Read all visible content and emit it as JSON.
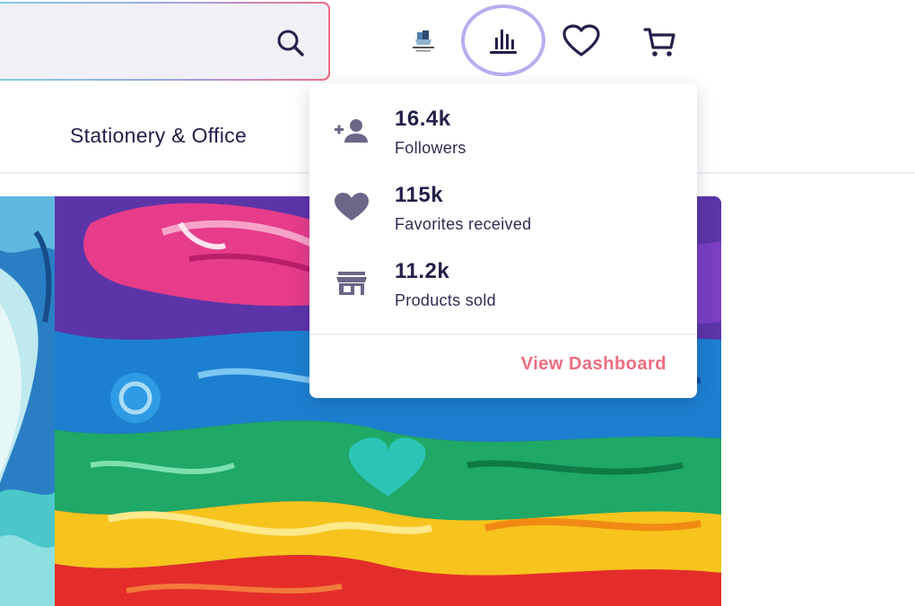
{
  "search": {
    "value": "",
    "placeholder": "",
    "icon": "search-icon"
  },
  "header": {
    "logo_icon": "shop-logo-icon",
    "stats_icon": "bar-chart-icon",
    "favorites_icon": "heart-outline-icon",
    "cart_icon": "cart-icon",
    "stats_ring_color": "#b7aef0"
  },
  "nav": {
    "items": [
      {
        "label": "Stationery & Office"
      }
    ]
  },
  "stats_panel": {
    "items": [
      {
        "icon": "add-follower-icon",
        "value": "16.4k",
        "label": "Followers"
      },
      {
        "icon": "heart-filled-icon",
        "value": "115k",
        "label": "Favorites received"
      },
      {
        "icon": "store-icon",
        "value": "11.2k",
        "label": "Products sold"
      }
    ],
    "link_label": "View Dashboard",
    "link_color": "#ef6c7e"
  },
  "colors": {
    "text": "#23204a",
    "accent": "#ef6c7e",
    "search_gradient": [
      "#7fd0dc",
      "#9fa4e6",
      "#ef6f86"
    ],
    "icon_gray": "#6a6788"
  }
}
